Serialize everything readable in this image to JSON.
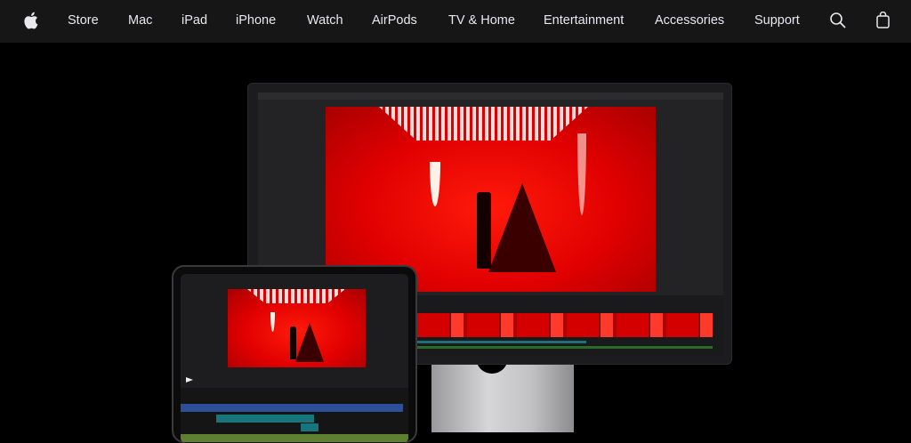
{
  "nav": {
    "logo": "apple-logo",
    "items": [
      {
        "label": "Store"
      },
      {
        "label": "Mac"
      },
      {
        "label": "iPad"
      },
      {
        "label": "iPhone"
      },
      {
        "label": "Watch"
      },
      {
        "label": "AirPods"
      },
      {
        "label": "TV & Home"
      },
      {
        "label": "Entertainment"
      },
      {
        "label": "Accessories"
      },
      {
        "label": "Support"
      }
    ],
    "search_icon": "search-icon",
    "bag_icon": "shopping-bag-icon"
  },
  "colors": {
    "nav_bg": "#161617",
    "nav_text": "#e8e8ed",
    "page_bg": "#000000",
    "accent_red": "#e00000"
  }
}
